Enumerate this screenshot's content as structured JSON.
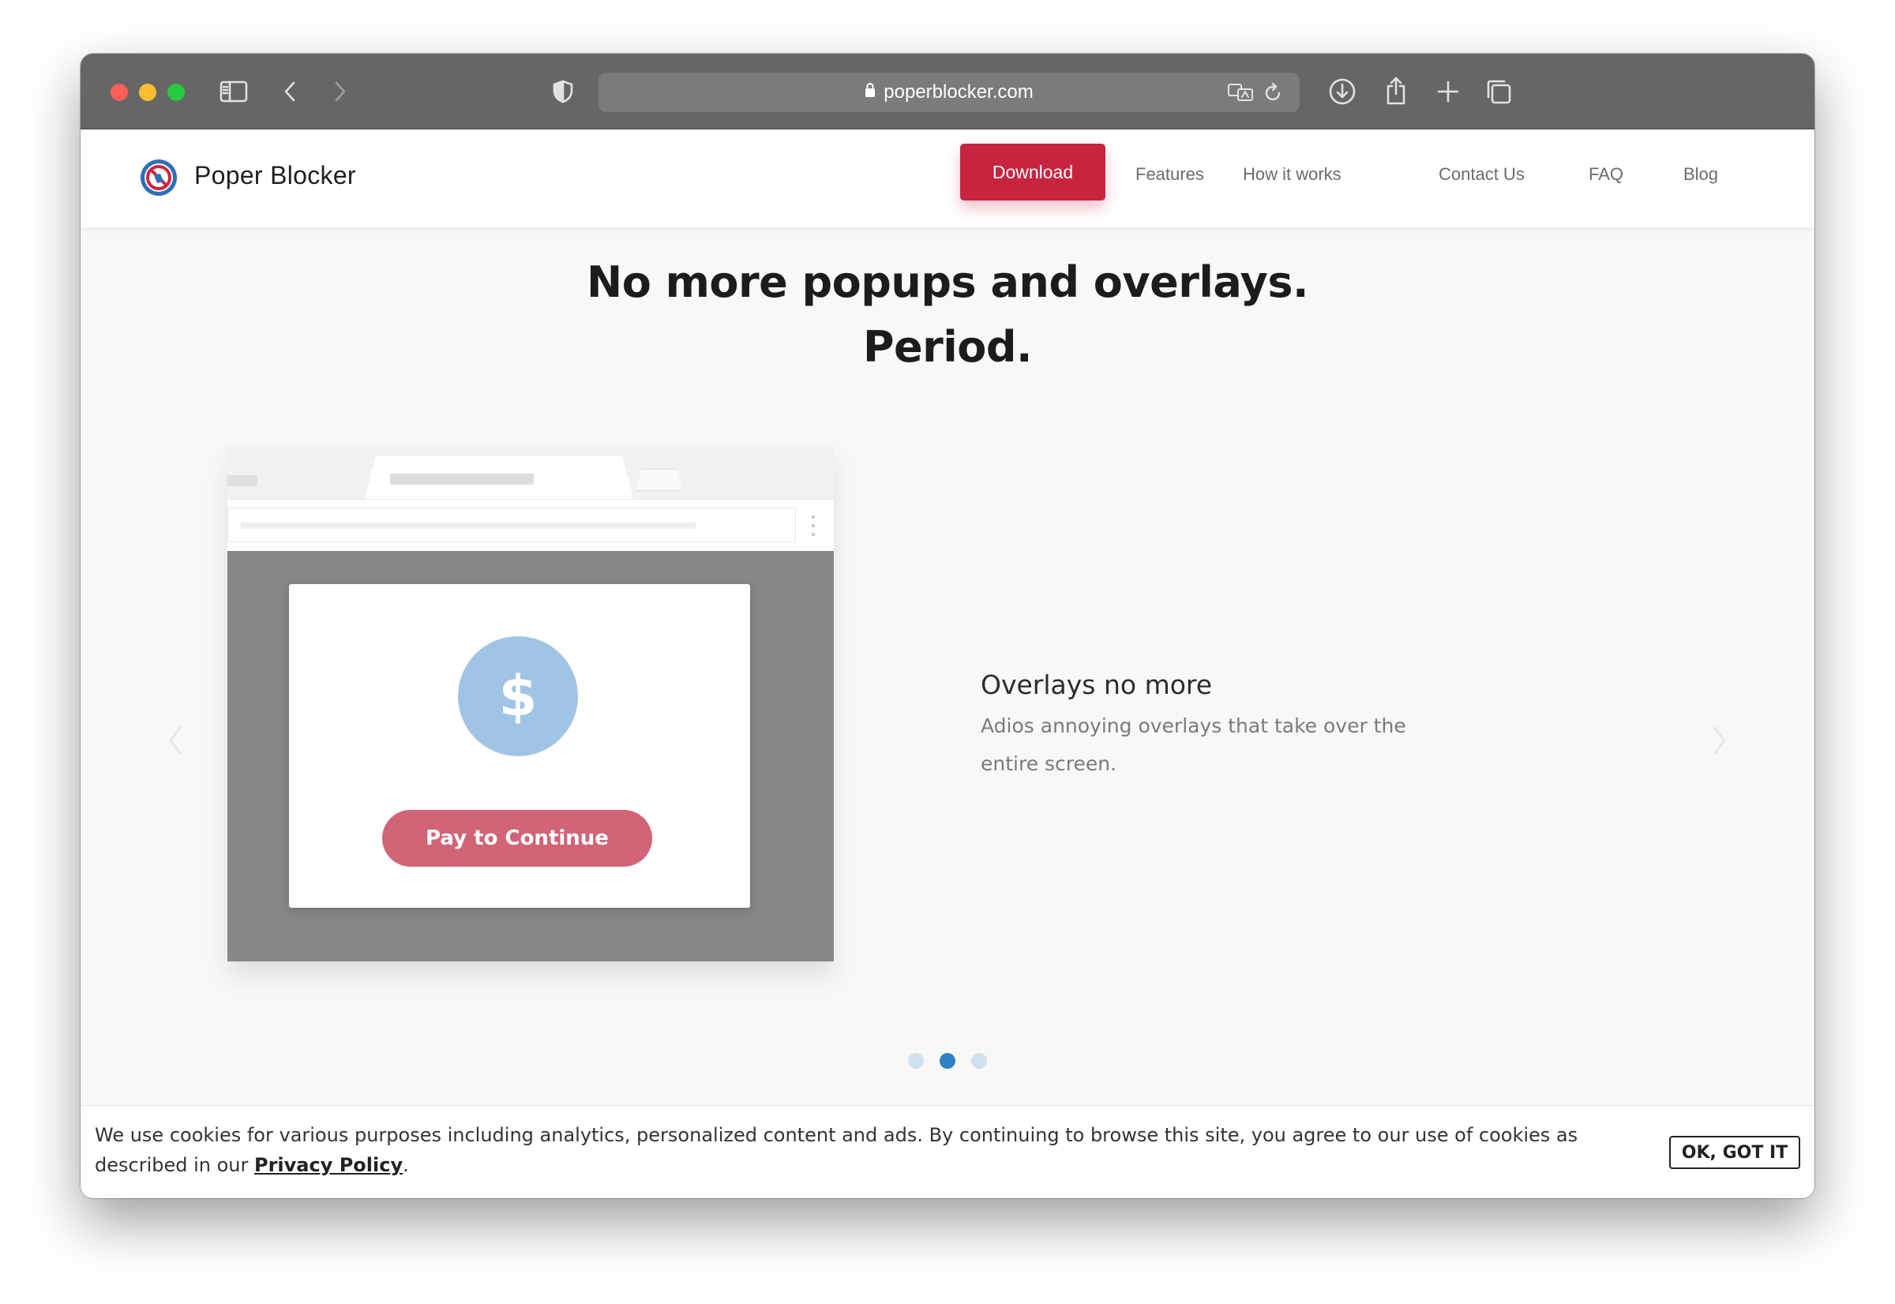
{
  "browser": {
    "url": "poperblocker.com"
  },
  "site": {
    "brand": "Poper Blocker",
    "nav": {
      "download": "Download",
      "features": "Features",
      "how_it_works": "How it works",
      "contact": "Contact Us",
      "faq": "FAQ",
      "blog": "Blog"
    },
    "accent_color": "#c8243f"
  },
  "hero": {
    "title_line1": "No more popups and overlays.",
    "title_line2": "Period."
  },
  "carousel": {
    "modal_symbol": "$",
    "modal_button": "Pay to Continue",
    "slide_title": "Overlays no more",
    "slide_description": "Adios annoying overlays that take over the entire screen.",
    "active_slide": 2,
    "total_slides": 3
  },
  "cookie_bar": {
    "text": "We use cookies for various purposes including analytics, personalized content and ads. By continuing to browse this site, you agree to our use of cookies as described in our ",
    "link_text": "Privacy Policy",
    "suffix": ".",
    "button": "OK, GOT IT"
  }
}
